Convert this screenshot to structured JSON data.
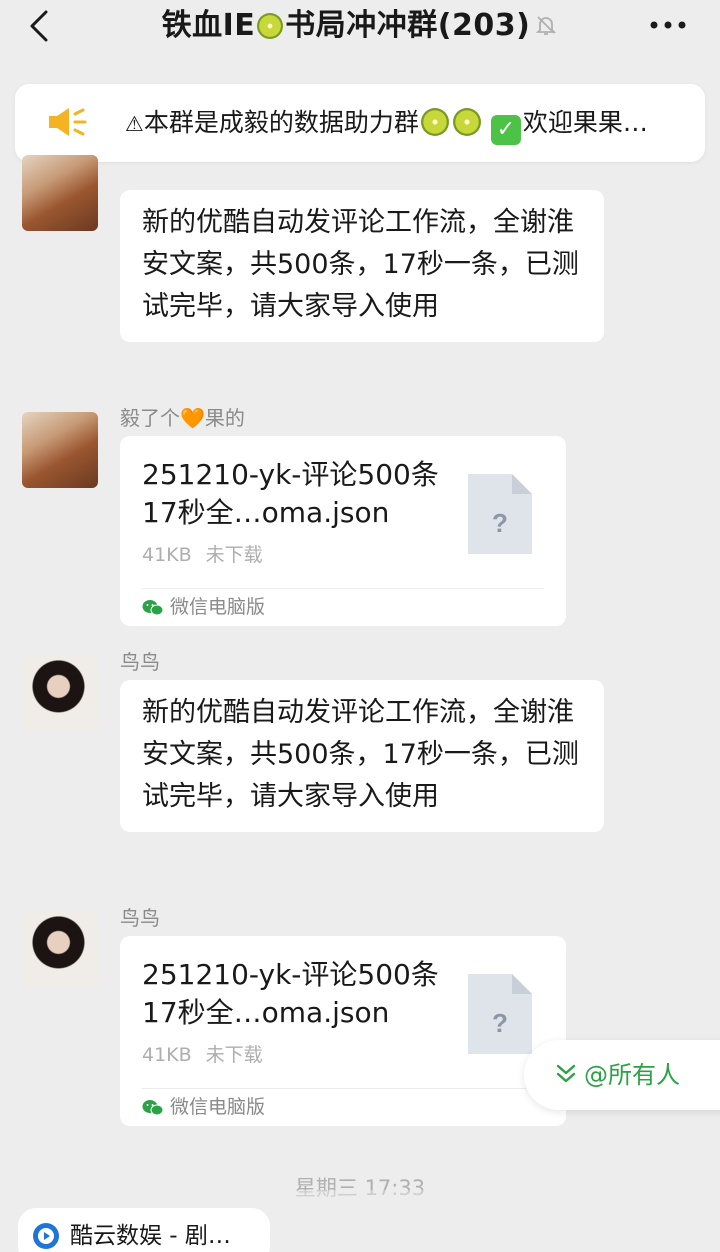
{
  "header": {
    "title_part1": "铁血IE",
    "title_part2": "书局冲冲群(203)"
  },
  "notice": {
    "prefix": "⚠",
    "text": "本群是成毅的数据助力群",
    "suffix": "欢迎果果…"
  },
  "messages": [
    {
      "type": "text",
      "sender": "",
      "text": "新的优酷自动发评论工作流，全谢淮安文案，共500条，17秒一条，已测试完毕，请大家导入使用"
    },
    {
      "type": "file",
      "sender_part1": "毅了个",
      "sender_heart": "🧡",
      "sender_part2": "果的",
      "file_name": "251210-yk-评论500条17秒全…oma.json",
      "file_size": "41KB",
      "file_status": "未下载",
      "file_icon_glyph": "?",
      "source": "微信电脑版"
    },
    {
      "type": "text",
      "sender": "鸟鸟",
      "text": "新的优酷自动发评论工作流，全谢淮安文案，共500条，17秒一条，已测试完毕，请大家导入使用"
    },
    {
      "type": "file",
      "sender": "鸟鸟",
      "file_name": "251210-yk-评论500条17秒全…oma.json",
      "file_size": "41KB",
      "file_status": "未下载",
      "file_icon_glyph": "?",
      "source": "微信电脑版"
    }
  ],
  "mention_button": "@所有人",
  "timestamp": "星期三 17:33",
  "bottom_chip": "酷云数娱 - 剧…",
  "colors": {
    "background": "#ededed",
    "bubble": "#ffffff",
    "wechat_green": "#2ba245",
    "muted_text": "#8a8a8a",
    "notice_speaker": "#f5b223"
  },
  "icons": {
    "back": "chevron-left-icon",
    "mute": "bell-off-icon",
    "more": "more-dots-icon",
    "speaker": "speaker-icon",
    "file": "unknown-file-icon",
    "wechat": "wechat-icon",
    "mention": "double-chevron-down-icon",
    "chip": "play-circle-icon"
  }
}
